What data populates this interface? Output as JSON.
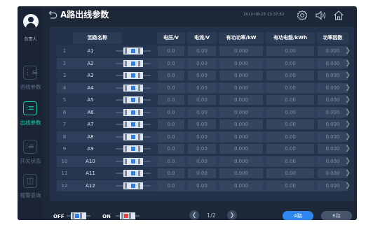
{
  "header": {
    "title": "A路出线参数",
    "datetime": "2022-08-23 13:37:52"
  },
  "user": {
    "label": "负责人"
  },
  "nav": [
    {
      "label": "进线参数",
      "icon": "incoming-line-icon",
      "active": false
    },
    {
      "label": "出线参数",
      "icon": "outgoing-line-icon",
      "active": true
    },
    {
      "label": "开关状态",
      "icon": "switch-status-icon",
      "active": false
    },
    {
      "label": "报警查询",
      "icon": "alarm-query-icon",
      "active": false
    }
  ],
  "table": {
    "columns": [
      "回路名称",
      "电压/V",
      "电流/V",
      "有功功率/kW",
      "有功电能/kWh",
      "功率因数"
    ],
    "rows": [
      {
        "index": "1",
        "name": "A1",
        "voltage": "0.0",
        "current": "0.00",
        "power": "0.000",
        "energy": "0.00",
        "pf": "0.000"
      },
      {
        "index": "2",
        "name": "A2",
        "voltage": "0.0",
        "current": "0.00",
        "power": "0.000",
        "energy": "0.00",
        "pf": "0.000"
      },
      {
        "index": "3",
        "name": "A3",
        "voltage": "0.0",
        "current": "0.00",
        "power": "0.000",
        "energy": "0.00",
        "pf": "0.000"
      },
      {
        "index": "4",
        "name": "A4",
        "voltage": "0.0",
        "current": "0.00",
        "power": "0.000",
        "energy": "0.00",
        "pf": "0.000"
      },
      {
        "index": "5",
        "name": "A5",
        "voltage": "0.0",
        "current": "0.00",
        "power": "0.000",
        "energy": "0.00",
        "pf": "0.000"
      },
      {
        "index": "6",
        "name": "A6",
        "voltage": "0.0",
        "current": "0.00",
        "power": "0.000",
        "energy": "0.00",
        "pf": "0.000"
      },
      {
        "index": "7",
        "name": "A7",
        "voltage": "0.0",
        "current": "0.00",
        "power": "0.000",
        "energy": "0.00",
        "pf": "0.000"
      },
      {
        "index": "8",
        "name": "A8",
        "voltage": "0.0",
        "current": "0.00",
        "power": "0.000",
        "energy": "0.00",
        "pf": "0.000"
      },
      {
        "index": "9",
        "name": "A9",
        "voltage": "0.0",
        "current": "0.00",
        "power": "0.000",
        "energy": "0.00",
        "pf": "0.000"
      },
      {
        "index": "10",
        "name": "A10",
        "voltage": "0.0",
        "current": "0.00",
        "power": "0.000",
        "energy": "0.00",
        "pf": "0.000"
      },
      {
        "index": "11",
        "name": "A11",
        "voltage": "0.0",
        "current": "0.00",
        "power": "0.000",
        "energy": "0.00",
        "pf": "0.000"
      },
      {
        "index": "12",
        "name": "A12",
        "voltage": "0.0",
        "current": "0.00",
        "power": "0.000",
        "energy": "0.00",
        "pf": "0.000"
      }
    ]
  },
  "footer": {
    "off_label": "OFF",
    "on_label": "ON",
    "page": "1/2",
    "route_a": "A路",
    "route_b": "B路"
  },
  "colors": {
    "accent": "#1ad0a4",
    "primary": "#2f86ee",
    "off_indicator": "#2e7fe0",
    "on_indicator": "#e04a45"
  }
}
